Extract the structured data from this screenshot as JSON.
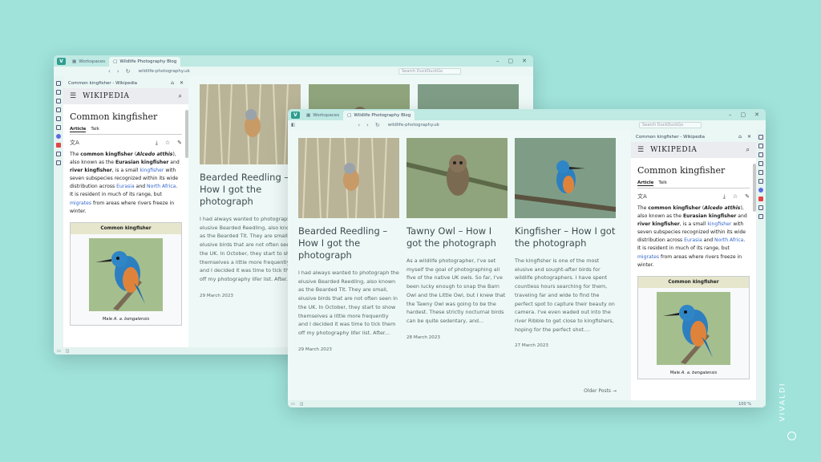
{
  "browser": {
    "workspaces_label": "Workspaces",
    "tab_title": "Wildlife Photography Blog",
    "url": "wildlife-photography.uk",
    "url_short": "wildlife-photography.uk",
    "search_placeholder": "Search DuckDuckGo"
  },
  "panel": {
    "title": "Common kingfisher - Wikipedia"
  },
  "wiki": {
    "wordmark": "WIKIPEDIA",
    "title": "Common kingfisher",
    "tab_article": "Article",
    "tab_talk": "Talk",
    "p1_bold1": "common kingfisher",
    "p1_sci": "Alcedo atthis",
    "p1_t2": "), also known as the ",
    "p1_bold2": "Eurasian kingfisher",
    "p1_t3": " and ",
    "p1_bold3": "river kingfisher",
    "p1_t4": ", is a small ",
    "p1_link1": "kingfisher",
    "p1_t5": " with seven subspecies recognized within its wide distribution across ",
    "p1_link2": "Eurasia",
    "p1_t6": " and ",
    "p1_link3": "North Africa",
    "p1_t7": ". It is resident in much of its range, but ",
    "p1_link4": "migrates",
    "p1_t8": " from areas where rivers freeze in winter.",
    "infobox_caption": "Common kingfisher",
    "infobox_sub_pre": "Male ",
    "infobox_sub_sci": "A. a. bengalensis"
  },
  "posts": [
    {
      "title": "Bearded Reedling – How I got the photograph",
      "excerpt": "I had always wanted to photograph the elusive Bearded Reedling, also known as the Bearded Tit. They are small, elusive birds that are not often seen in the UK. In October, they start to show themselves a little more frequently and I decided it was time to tick them off my photography lifer list. After...",
      "date": "29 March 2023"
    },
    {
      "title": "Tawny Owl – How I got the photograph",
      "excerpt": "As a wildlife photographer, I've set myself the goal of photographing all five of the native UK owls. So far, I've been lucky enough to snap the Barn Owl and the Little Owl, but I knew that the Tawny Owl was going to be the hardest. These strictly nocturnal birds can be quite sedentary, and...",
      "date": "28 March 2023"
    },
    {
      "title": "Kingfisher – How I got the photograph",
      "excerpt": "The kingfisher is one of the most elusive and sought-after birds for wildlife photographers. I have spent countless hours searching for them, traveling far and wide to find the perfect spot to capture their beauty on camera. I've even waded out into the river Ribble to get close to kingfishers, hoping for the perfect shot....",
      "date": "27 March 2023"
    }
  ],
  "older_posts": "Older Posts  →",
  "zoom": "100 %",
  "watermark": "VIVALDI"
}
